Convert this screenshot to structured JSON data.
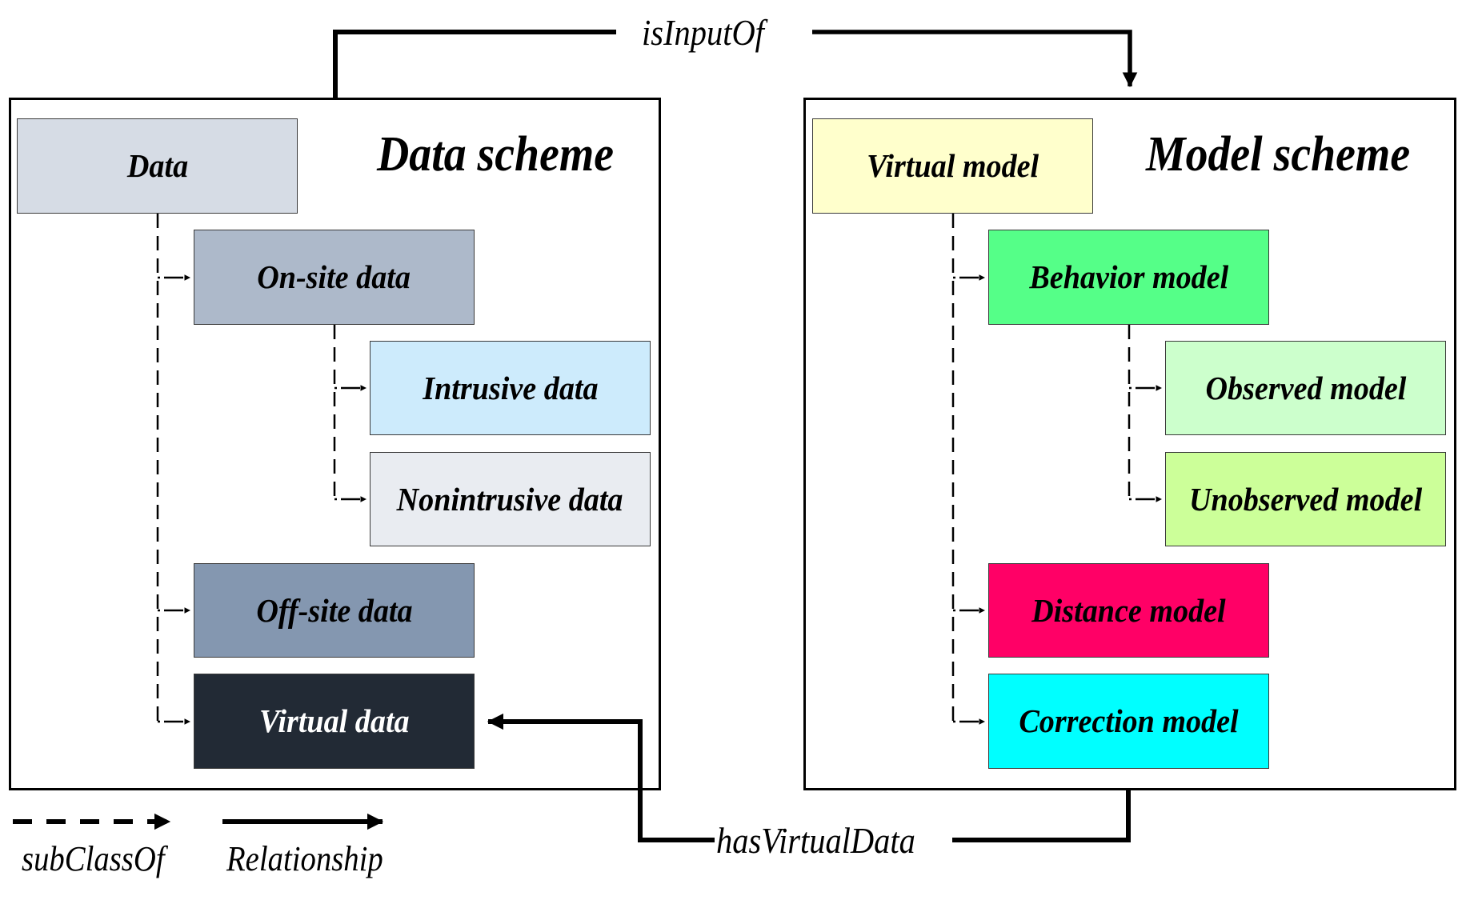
{
  "schemes": {
    "data": {
      "title": "Data scheme",
      "nodes": {
        "data": {
          "label": "Data",
          "fill": "#D6DCE5",
          "text_color": "#000000"
        },
        "onsite": {
          "label": "On-site data",
          "fill": "#ADB9CA",
          "text_color": "#000000"
        },
        "intrusive": {
          "label": "Intrusive data",
          "fill": "#CDEBFC",
          "text_color": "#000000"
        },
        "nonintrusive": {
          "label": "Nonintrusive data",
          "fill": "#E9ECF1",
          "text_color": "#000000"
        },
        "offsite": {
          "label": "Off-site data",
          "fill": "#8497B0",
          "text_color": "#000000"
        },
        "virtualdata": {
          "label": "Virtual data",
          "fill": "#222A35",
          "text_color": "#FFFFFF"
        }
      }
    },
    "model": {
      "title": "Model scheme",
      "nodes": {
        "virtualmodel": {
          "label": "Virtual model",
          "fill": "#FFFFCC",
          "text_color": "#000000"
        },
        "behavior": {
          "label": "Behavior model",
          "fill": "#55FF88",
          "text_color": "#000000"
        },
        "observed": {
          "label": "Observed model",
          "fill": "#CCFFCC",
          "text_color": "#000000"
        },
        "unobserved": {
          "label": "Unobserved model",
          "fill": "#CCFF99",
          "text_color": "#000000"
        },
        "distance": {
          "label": "Distance model",
          "fill": "#FF0066",
          "text_color": "#000000"
        },
        "correction": {
          "label": "Correction model",
          "fill": "#00FFFF",
          "text_color": "#000000"
        }
      }
    }
  },
  "subclass_edges": [
    {
      "parent": "data",
      "child": "onsite"
    },
    {
      "parent": "data",
      "child": "offsite"
    },
    {
      "parent": "data",
      "child": "virtualdata"
    },
    {
      "parent": "onsite",
      "child": "intrusive"
    },
    {
      "parent": "onsite",
      "child": "nonintrusive"
    },
    {
      "parent": "virtualmodel",
      "child": "behavior"
    },
    {
      "parent": "virtualmodel",
      "child": "distance"
    },
    {
      "parent": "virtualmodel",
      "child": "correction"
    },
    {
      "parent": "behavior",
      "child": "observed"
    },
    {
      "parent": "behavior",
      "child": "unobserved"
    }
  ],
  "relationships": {
    "is_input_of": {
      "label": "isInputOf",
      "from": "Data scheme",
      "to": "Model scheme"
    },
    "has_virtual_data": {
      "label": "hasVirtualData",
      "from": "Model scheme",
      "to": "Virtual data"
    }
  },
  "legend": {
    "subclass_label": "subClassOf",
    "relationship_label": "Relationship"
  }
}
